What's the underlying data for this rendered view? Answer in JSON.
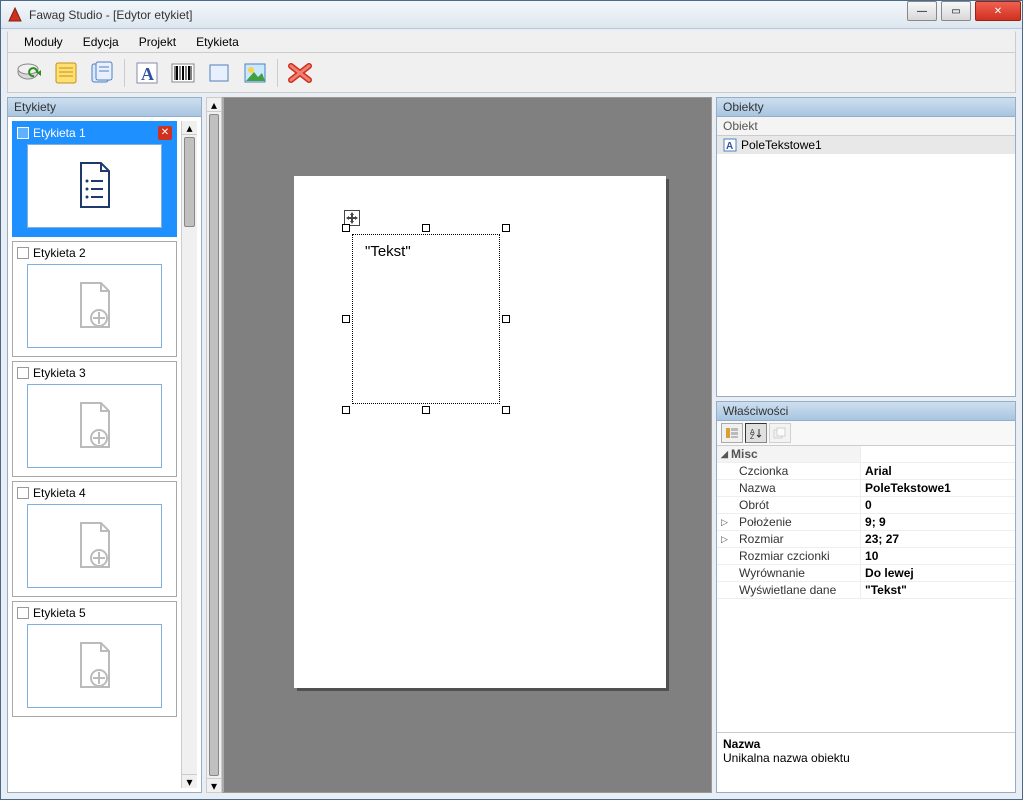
{
  "window": {
    "title": "Fawag Studio - [Edytor etykiet]"
  },
  "menu": {
    "items": [
      "Moduły",
      "Edycja",
      "Projekt",
      "Etykieta"
    ]
  },
  "toolbar": {
    "icons": [
      "refresh-db",
      "form",
      "notes",
      "text-tool",
      "barcode",
      "rect",
      "image",
      "delete"
    ]
  },
  "leftPanel": {
    "title": "Etykiety",
    "items": [
      {
        "label": "Etykieta 1",
        "selected": true,
        "closable": true
      },
      {
        "label": "Etykieta 2",
        "selected": false,
        "closable": false
      },
      {
        "label": "Etykieta 3",
        "selected": false,
        "closable": false
      },
      {
        "label": "Etykieta 4",
        "selected": false,
        "closable": false
      },
      {
        "label": "Etykieta 5",
        "selected": false,
        "closable": false
      }
    ]
  },
  "canvas": {
    "textbox": {
      "text": "\"Tekst\""
    }
  },
  "objectsPanel": {
    "title": "Obiekty",
    "columnHeader": "Obiekt",
    "items": [
      {
        "label": "PoleTekstowe1",
        "selected": true
      }
    ]
  },
  "propsPanel": {
    "title": "Właściwości",
    "category": "Misc",
    "rows": [
      {
        "name": "Czcionka",
        "value": "Arial",
        "expand": ""
      },
      {
        "name": "Nazwa",
        "value": "PoleTekstowe1",
        "expand": ""
      },
      {
        "name": "Obrót",
        "value": "0",
        "expand": ""
      },
      {
        "name": "Położenie",
        "value": "9; 9",
        "expand": "▷"
      },
      {
        "name": "Rozmiar",
        "value": "23; 27",
        "expand": "▷"
      },
      {
        "name": "Rozmiar czcionki",
        "value": "10",
        "expand": ""
      },
      {
        "name": "Wyrównanie",
        "value": "Do lewej",
        "expand": ""
      },
      {
        "name": "Wyświetlane dane",
        "value": "\"Tekst\"",
        "expand": ""
      }
    ],
    "descTitle": "Nazwa",
    "descText": "Unikalna nazwa obiektu"
  }
}
